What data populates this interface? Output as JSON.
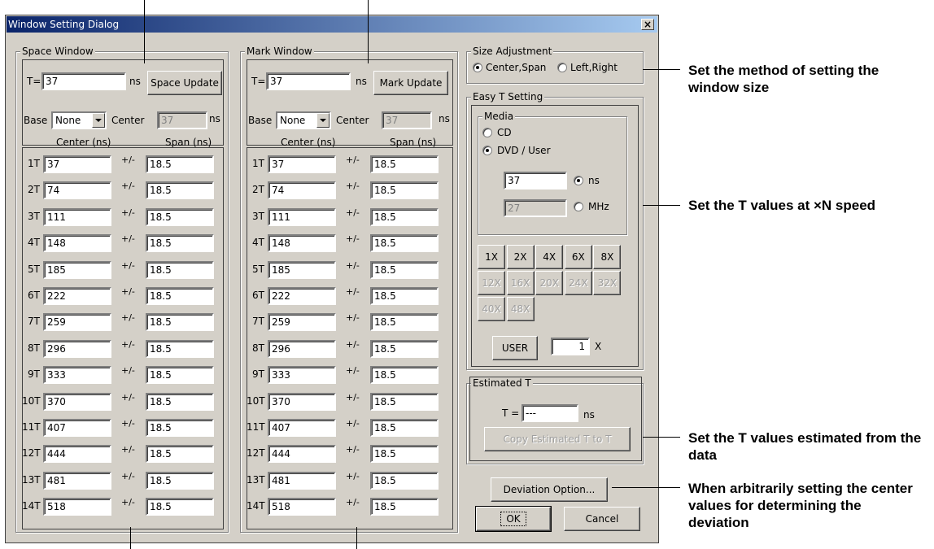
{
  "window": {
    "title": "Window Setting Dialog",
    "close": "×"
  },
  "space_window": {
    "legend": "Space Window",
    "t_label": "T=",
    "t_value": "37",
    "unit": "ns",
    "update_button": "Space Update",
    "base_label": "Base",
    "base_value": "None",
    "center_label": "Center",
    "center_value": "37",
    "center_unit": "ns",
    "col_center": "Center (ns)",
    "col_span": "Span (ns)",
    "pm": "+/-",
    "rows": [
      {
        "label": "1T",
        "center": "37",
        "span": "18.5"
      },
      {
        "label": "2T",
        "center": "74",
        "span": "18.5"
      },
      {
        "label": "3T",
        "center": "111",
        "span": "18.5"
      },
      {
        "label": "4T",
        "center": "148",
        "span": "18.5"
      },
      {
        "label": "5T",
        "center": "185",
        "span": "18.5"
      },
      {
        "label": "6T",
        "center": "222",
        "span": "18.5"
      },
      {
        "label": "7T",
        "center": "259",
        "span": "18.5"
      },
      {
        "label": "8T",
        "center": "296",
        "span": "18.5"
      },
      {
        "label": "9T",
        "center": "333",
        "span": "18.5"
      },
      {
        "label": "10T",
        "center": "370",
        "span": "18.5"
      },
      {
        "label": "11T",
        "center": "407",
        "span": "18.5"
      },
      {
        "label": "12T",
        "center": "444",
        "span": "18.5"
      },
      {
        "label": "13T",
        "center": "481",
        "span": "18.5"
      },
      {
        "label": "14T",
        "center": "518",
        "span": "18.5"
      }
    ]
  },
  "mark_window": {
    "legend": "Mark Window",
    "t_label": "T=",
    "t_value": "37",
    "unit": "ns",
    "update_button": "Mark Update",
    "base_label": "Base",
    "base_value": "None",
    "center_label": "Center",
    "center_value": "37",
    "center_unit": "ns",
    "col_center": "Center (ns)",
    "col_span": "Span (ns)",
    "pm": "+/-",
    "rows": [
      {
        "label": "1T",
        "center": "37",
        "span": "18.5"
      },
      {
        "label": "2T",
        "center": "74",
        "span": "18.5"
      },
      {
        "label": "3T",
        "center": "111",
        "span": "18.5"
      },
      {
        "label": "4T",
        "center": "148",
        "span": "18.5"
      },
      {
        "label": "5T",
        "center": "185",
        "span": "18.5"
      },
      {
        "label": "6T",
        "center": "222",
        "span": "18.5"
      },
      {
        "label": "7T",
        "center": "259",
        "span": "18.5"
      },
      {
        "label": "8T",
        "center": "296",
        "span": "18.5"
      },
      {
        "label": "9T",
        "center": "333",
        "span": "18.5"
      },
      {
        "label": "10T",
        "center": "370",
        "span": "18.5"
      },
      {
        "label": "11T",
        "center": "407",
        "span": "18.5"
      },
      {
        "label": "12T",
        "center": "444",
        "span": "18.5"
      },
      {
        "label": "13T",
        "center": "481",
        "span": "18.5"
      },
      {
        "label": "14T",
        "center": "518",
        "span": "18.5"
      }
    ]
  },
  "size_adjustment": {
    "legend": "Size Adjustment",
    "options": [
      "Center,Span",
      "Left,Right"
    ],
    "selected": "Center,Span"
  },
  "easy_t": {
    "legend": "Easy T Setting",
    "media_legend": "Media",
    "media_options": [
      "CD",
      "DVD / User"
    ],
    "media_selected": "DVD / User",
    "ns_value": "37",
    "ns_label": "ns",
    "mhz_value": "27",
    "mhz_label": "MHz",
    "unit_selected": "ns",
    "speeds": [
      {
        "label": "1X",
        "enabled": true
      },
      {
        "label": "2X",
        "enabled": true
      },
      {
        "label": "4X",
        "enabled": true
      },
      {
        "label": "6X",
        "enabled": true
      },
      {
        "label": "8X",
        "enabled": true
      },
      {
        "label": "12X",
        "enabled": false
      },
      {
        "label": "16X",
        "enabled": false
      },
      {
        "label": "20X",
        "enabled": false
      },
      {
        "label": "24X",
        "enabled": false
      },
      {
        "label": "32X",
        "enabled": false
      },
      {
        "label": "40X",
        "enabled": false
      },
      {
        "label": "48X",
        "enabled": false
      }
    ],
    "user_button": "USER",
    "user_value": "1",
    "user_unit": "X"
  },
  "estimated_t": {
    "legend": "Estimated T",
    "t_label": "T =",
    "t_value": "---",
    "unit": "ns",
    "copy_button": "Copy Estimated T to T"
  },
  "buttons": {
    "deviation": "Deviation Option...",
    "ok": "OK",
    "cancel": "Cancel"
  },
  "annotations": {
    "size_method": "Set the method of setting the window size",
    "t_values_speed": "Set the T values at ×N speed",
    "t_estimated": "Set the T values estimated from the data",
    "deviation": "When arbitrarily setting the center values for determining the deviation"
  }
}
